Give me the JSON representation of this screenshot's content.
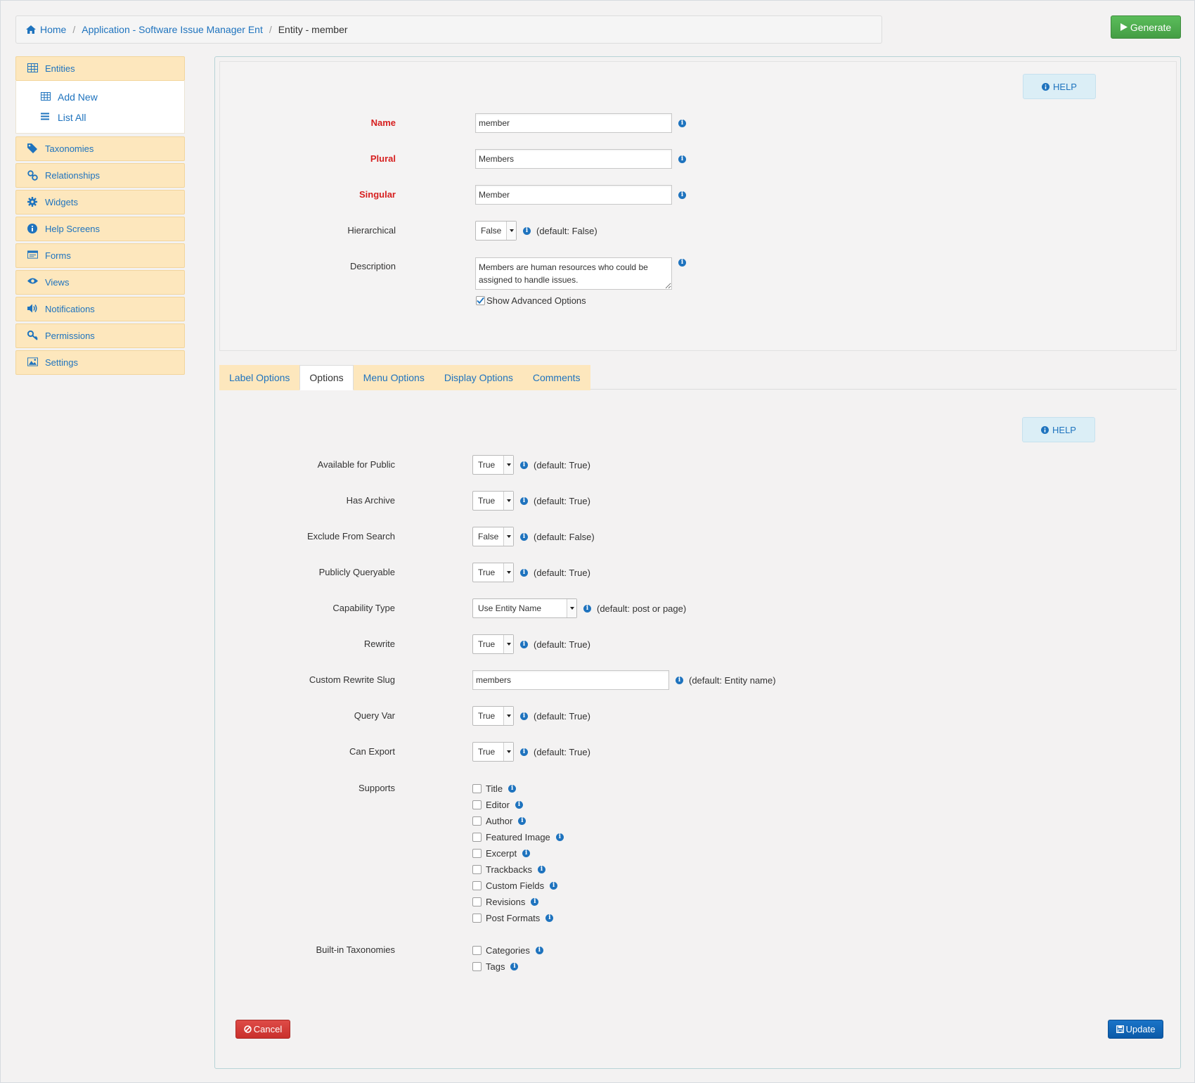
{
  "breadcrumb": {
    "home": "Home",
    "app": "Application - Software Issue Manager Ent",
    "current": "Entity - member",
    "separator": "/"
  },
  "toolbar": {
    "generate_label": "Generate"
  },
  "sidebar": {
    "entities": "Entities",
    "sub_items": {
      "add_new": "Add New",
      "list_all": "List All"
    },
    "taxonomies": "Taxonomies",
    "relationships": "Relationships",
    "widgets": "Widgets",
    "help_screens": "Help Screens",
    "forms": "Forms",
    "views": "Views",
    "notifications": "Notifications",
    "permissions": "Permissions",
    "settings": "Settings"
  },
  "help_label": "HELP",
  "info_glyph": "i",
  "general": {
    "name": {
      "label": "Name",
      "value": "member"
    },
    "plural": {
      "label": "Plural",
      "value": "Members"
    },
    "singular": {
      "label": "Singular",
      "value": "Member"
    },
    "hierarchical": {
      "label": "Hierarchical",
      "value": "False",
      "default": "(default: False)"
    },
    "description": {
      "label": "Description",
      "value": "Members are human resources who could be assigned to handle issues."
    },
    "advanced": {
      "label": "Show Advanced Options",
      "checked": true
    }
  },
  "tabs": {
    "label_options": "Label Options",
    "options": "Options",
    "menu_options": "Menu Options",
    "display_options": "Display Options",
    "comments": "Comments"
  },
  "options": {
    "available_public": {
      "label": "Available for Public",
      "value": "True",
      "default": "(default: True)"
    },
    "has_archive": {
      "label": "Has Archive",
      "value": "True",
      "default": "(default: True)"
    },
    "exclude_search": {
      "label": "Exclude From Search",
      "value": "False",
      "default": "(default: False)"
    },
    "publicly_queryable": {
      "label": "Publicly Queryable",
      "value": "True",
      "default": "(default: True)"
    },
    "capability_type": {
      "label": "Capability Type",
      "value": "Use Entity Name",
      "default": "(default: post or page)"
    },
    "rewrite": {
      "label": "Rewrite",
      "value": "True",
      "default": "(default: True)"
    },
    "rewrite_slug": {
      "label": "Custom Rewrite Slug",
      "value": "members",
      "default": "(default: Entity name)"
    },
    "query_var": {
      "label": "Query Var",
      "value": "True",
      "default": "(default: True)"
    },
    "can_export": {
      "label": "Can Export",
      "value": "True",
      "default": "(default: True)"
    },
    "supports": {
      "label": "Supports",
      "items": [
        "Title",
        "Editor",
        "Author",
        "Featured Image",
        "Excerpt",
        "Trackbacks",
        "Custom Fields",
        "Revisions",
        "Post Formats"
      ]
    },
    "taxonomies": {
      "label": "Built-in Taxonomies",
      "items": [
        "Categories",
        "Tags"
      ]
    }
  },
  "actions": {
    "cancel": "Cancel",
    "update": "Update"
  },
  "colors": {
    "link": "#1e73be",
    "required": "#d61f1f",
    "sidebar_bg": "#fde7bd",
    "generate": "#449d44",
    "cancel": "#c9302c",
    "update": "#0b5aa8"
  }
}
